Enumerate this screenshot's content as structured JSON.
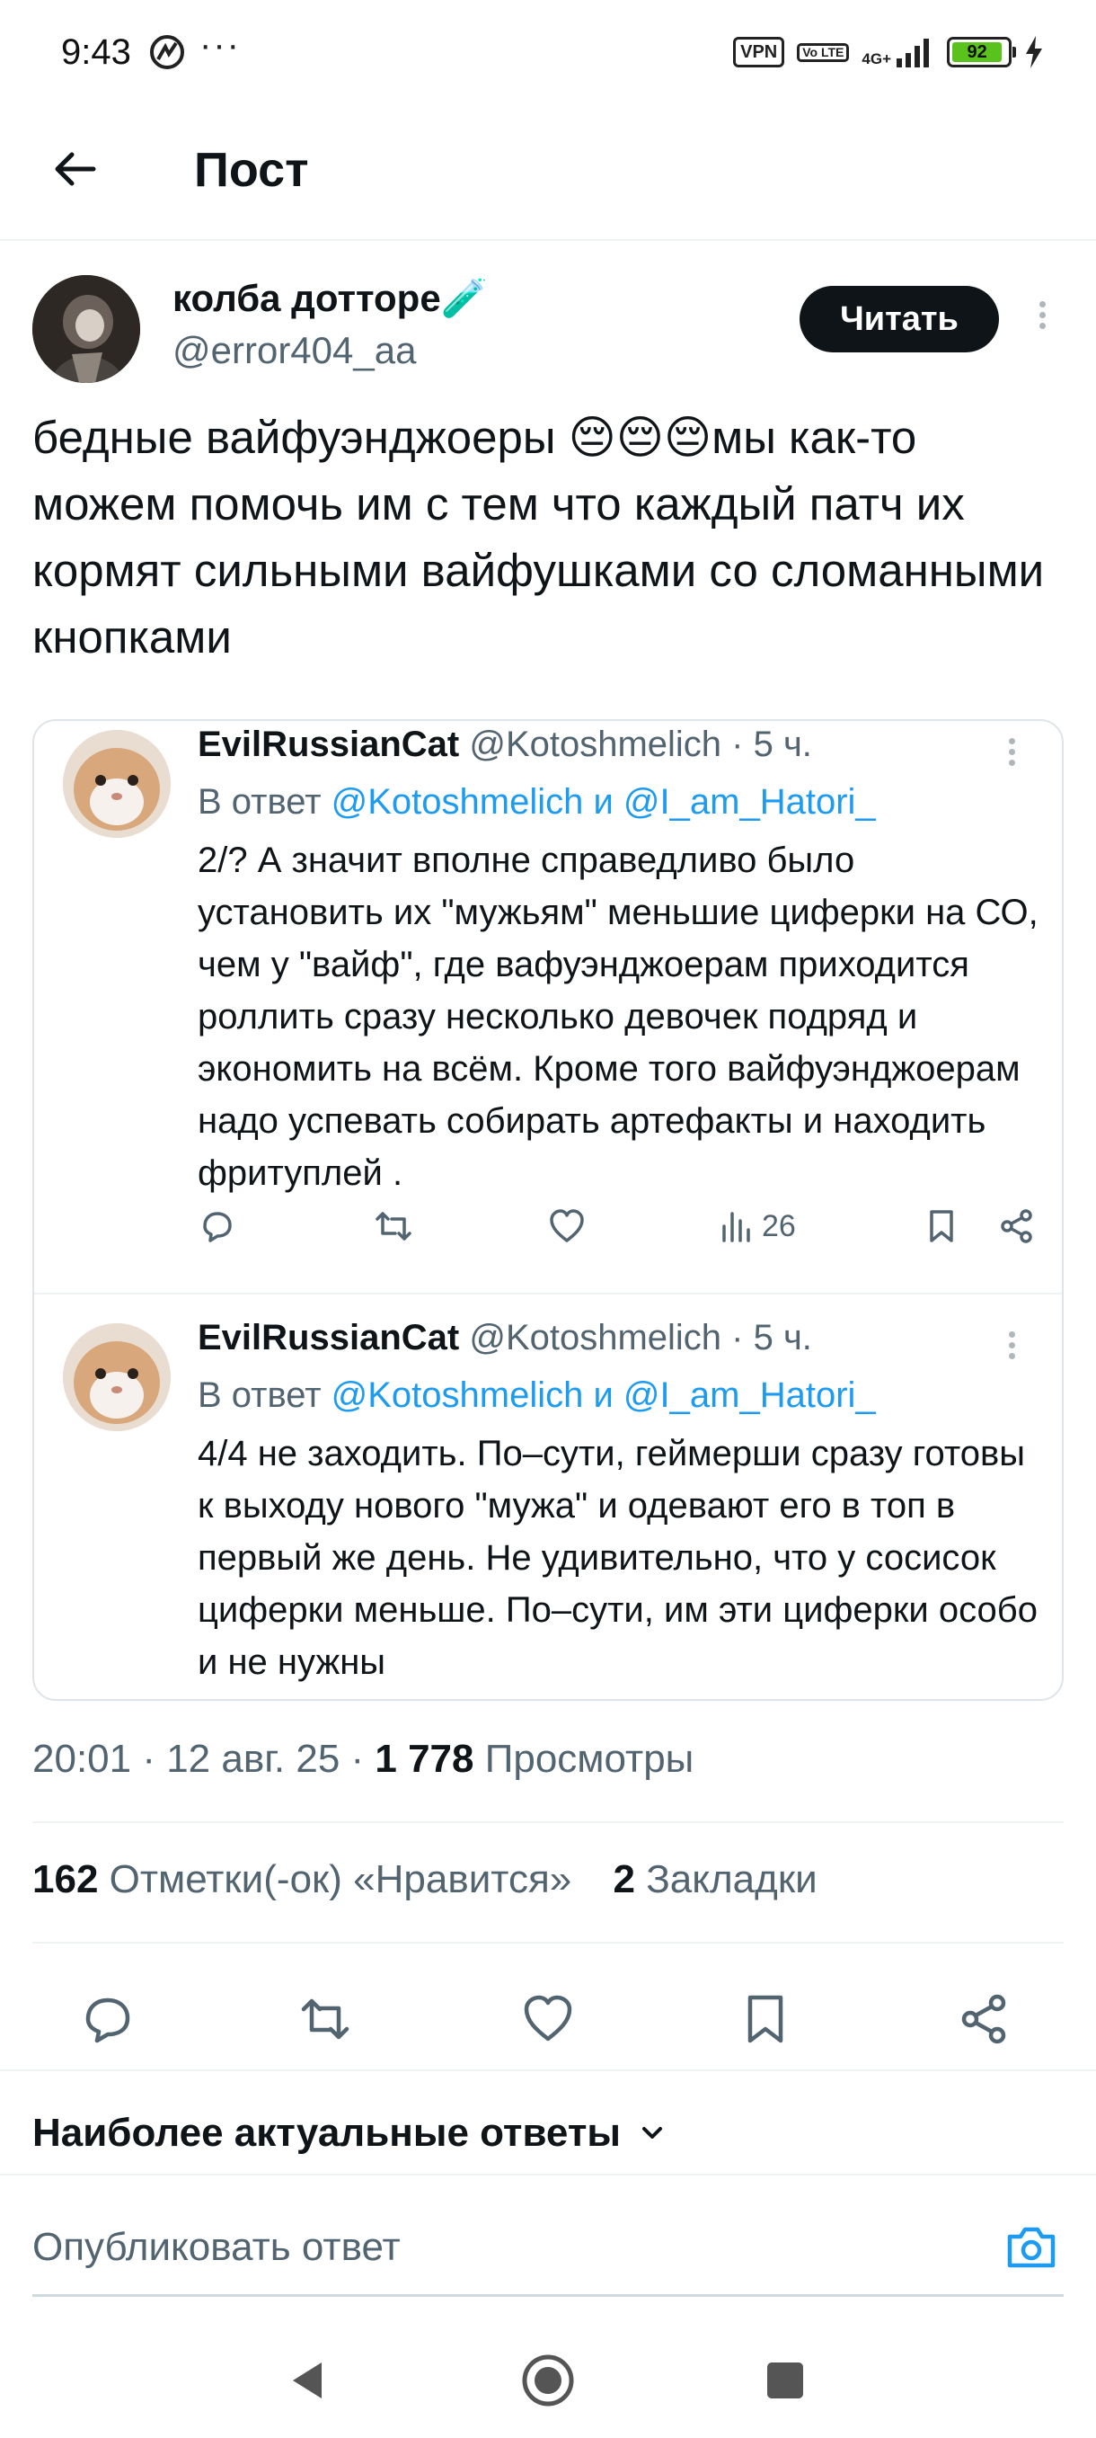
{
  "status_bar": {
    "time": "9:43",
    "dots": "···",
    "vpn": "VPN",
    "volte": "Vo LTE",
    "network": "4G+",
    "battery": "92",
    "battery_percent": 92
  },
  "header": {
    "title": "Пост"
  },
  "post": {
    "author_name": "колба дотторе",
    "author_emoji": "🧪",
    "author_handle": "@error404_aa",
    "follow_label": "Читать",
    "text": "бедные вайфуэнджоеры 😔😔😔мы как-то можем помочь им с тем что каждый патч их кормят сильными вайфушками со сломанными кнопками"
  },
  "quoted_replies": [
    {
      "name": "EvilRussianCat",
      "meta": " @Kotoshmelich · 5 ч.",
      "reply_prefix": "В ответ ",
      "mentions": "@Kotoshmelich и @I_am_Hatori_",
      "text": "2/? А значит вполне справедливо было установить их \"мужьям\" меньшие циферки на СО, чем у \"вайф\", где вафуэнджоерам приходится роллить сразу несколько девочек подряд и экономить на всём. Кроме того вайфуэнджоерам надо успевать собирать артефакты и находить фритуплей .",
      "views": "26"
    },
    {
      "name": "EvilRussianCat",
      "meta": " @Kotoshmelich · 5 ч.",
      "reply_prefix": "В ответ ",
      "mentions": "@Kotoshmelich и @I_am_Hatori_",
      "text": "4/4 не заходить. По–сути, геймерши сразу готовы к выходу нового \"мужа\" и одевают его в топ в первый же день. Не удивительно, что у сосисок циферки меньше. По–сути, им эти циферки особо и не нужны"
    }
  ],
  "meta_line": {
    "time_date": "20:01 · 12 авг. 25 · ",
    "views_count": "1 778",
    "views_label": " Просмотры"
  },
  "stats": {
    "likes_count": "162",
    "likes_label": " Отметки(-ок) «Нравится»",
    "bookmarks_count": "2",
    "bookmarks_label": " Закладки"
  },
  "replies_sort": {
    "label": "Наиболее актуальные ответы"
  },
  "reply_box": {
    "placeholder": "Опубликовать ответ"
  },
  "colors": {
    "text": "#0f1419",
    "secondary": "#536471",
    "accent": "#1d9bf0",
    "divider": "#eff3f4",
    "button_bg": "#0f1419"
  },
  "icons": [
    "back-arrow-icon",
    "more-vertical-icon",
    "reply-icon",
    "retweet-icon",
    "like-icon",
    "views-icon",
    "bookmark-icon",
    "share-icon",
    "chevron-down-icon",
    "camera-icon",
    "nav-back-icon",
    "nav-home-icon",
    "nav-recents-icon"
  ]
}
